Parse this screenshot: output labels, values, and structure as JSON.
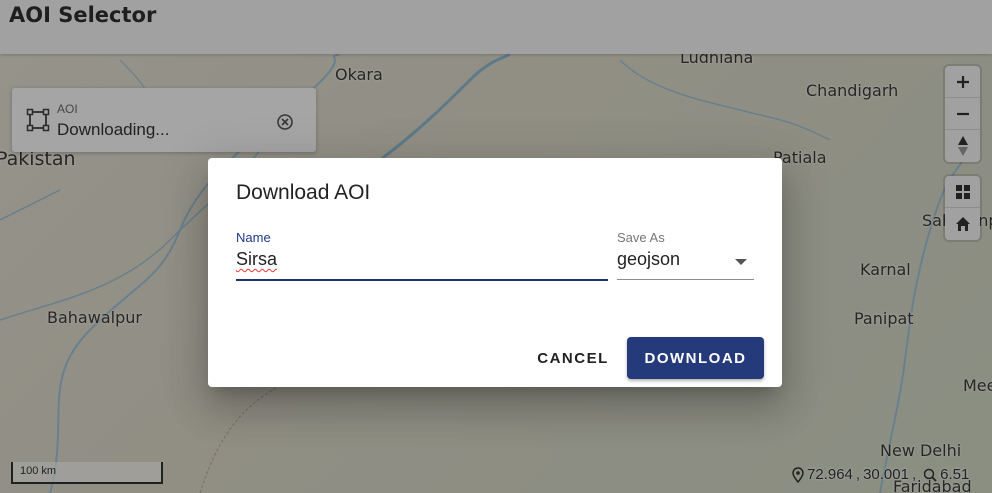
{
  "app": {
    "title": "AOI Selector"
  },
  "map": {
    "cities": [
      {
        "name": "Okara"
      },
      {
        "name": "Ludhiana"
      },
      {
        "name": "Chandigarh"
      },
      {
        "name": "Pakistan"
      },
      {
        "name": "Patiala"
      },
      {
        "name": "Saharanpur"
      },
      {
        "name": "Karnal"
      },
      {
        "name": "Bahawalpur"
      },
      {
        "name": "Panipat"
      },
      {
        "name": "Meerut"
      },
      {
        "name": "New Delhi"
      },
      {
        "name": "Faridabad"
      }
    ],
    "scale_label": "100 km",
    "coords": {
      "lon": "72.964",
      "lat": "30.001",
      "zoom": "6.51"
    },
    "controls": [
      "zoom-in-icon",
      "zoom-out-icon",
      "compass-icon",
      "grid-icon",
      "home-icon"
    ],
    "colors": {
      "land": "#dcd9c8",
      "water": "#9fc3d6"
    }
  },
  "aoi_panel": {
    "label": "AOI",
    "status": "Downloading...",
    "icon": "polygon-select-icon"
  },
  "dialog": {
    "title": "Download AOI",
    "name_label": "Name",
    "name_value": "Sirsa",
    "save_as_label": "Save As",
    "save_as_value": "geojson",
    "cancel_label": "CANCEL",
    "download_label": "DOWNLOAD",
    "accent_color": "#243a7a"
  }
}
